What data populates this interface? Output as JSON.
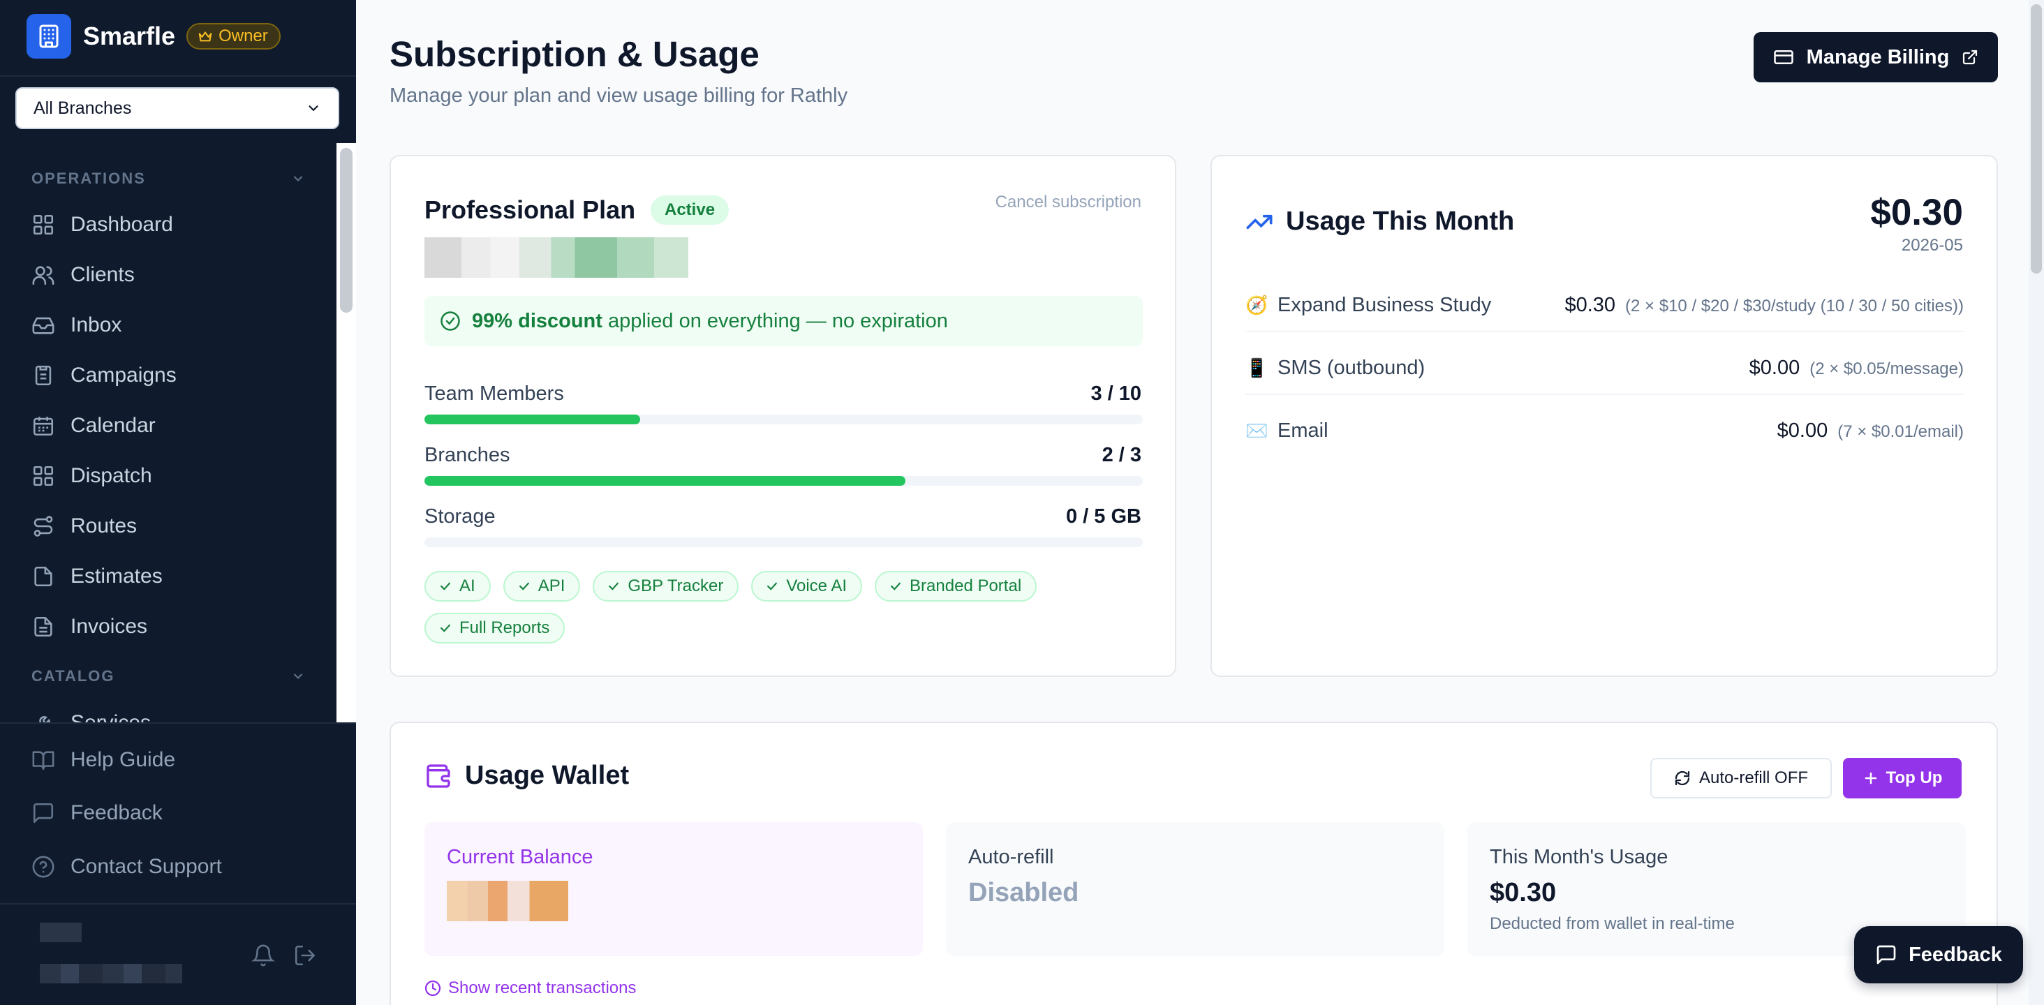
{
  "sidebar": {
    "brand": "Smarfle",
    "role_badge": "Owner",
    "branch_select": "All Branches",
    "sections": [
      {
        "label": "OPERATIONS",
        "items": [
          {
            "label": "Dashboard",
            "icon": "dashboard-icon"
          },
          {
            "label": "Clients",
            "icon": "clients-icon"
          },
          {
            "label": "Inbox",
            "icon": "inbox-icon"
          },
          {
            "label": "Campaigns",
            "icon": "campaigns-icon"
          },
          {
            "label": "Calendar",
            "icon": "calendar-icon"
          },
          {
            "label": "Dispatch",
            "icon": "dispatch-icon"
          },
          {
            "label": "Routes",
            "icon": "routes-icon"
          },
          {
            "label": "Estimates",
            "icon": "estimates-icon"
          },
          {
            "label": "Invoices",
            "icon": "invoices-icon"
          }
        ]
      },
      {
        "label": "CATALOG",
        "items": [
          {
            "label": "Services",
            "icon": "services-icon"
          }
        ]
      }
    ],
    "bottom": [
      {
        "label": "Help Guide",
        "icon": "book-icon"
      },
      {
        "label": "Feedback",
        "icon": "message-icon"
      },
      {
        "label": "Contact Support",
        "icon": "help-circle-icon"
      }
    ]
  },
  "header": {
    "title": "Subscription & Usage",
    "subtitle": "Manage your plan and view usage billing for Rathly",
    "manage_billing": "Manage Billing"
  },
  "plan": {
    "name": "Professional Plan",
    "status": "Active",
    "cancel": "Cancel subscription",
    "discount_bold": "99% discount",
    "discount_rest": "applied on everything — no expiration",
    "meters": [
      {
        "label": "Team Members",
        "value": "3 / 10",
        "fraction": 0.3
      },
      {
        "label": "Branches",
        "value": "2 / 3",
        "fraction": 0.67
      },
      {
        "label": "Storage",
        "value": "0 / 5 GB",
        "fraction": 0.0
      }
    ],
    "features": [
      "AI",
      "API",
      "GBP Tracker",
      "Voice AI",
      "Branded Portal",
      "Full Reports"
    ]
  },
  "usage": {
    "title": "Usage This Month",
    "total": "$0.30",
    "month": "2026-05",
    "rows": [
      {
        "icon": "compass-icon",
        "glyph": "🧭",
        "label": "Expand Business Study",
        "price": "$0.30",
        "detail": "(2 × $10 / $20 / $30/study (10 / 30 / 50 cities))"
      },
      {
        "icon": "phone-icon",
        "glyph": "📱",
        "label": "SMS (outbound)",
        "price": "$0.00",
        "detail": "(2 × $0.05/message)"
      },
      {
        "icon": "mail-icon",
        "glyph": "✉️",
        "label": "Email",
        "price": "$0.00",
        "detail": "(7 × $0.01/email)"
      }
    ]
  },
  "wallet": {
    "title": "Usage Wallet",
    "autorefill_button": "Auto-refill OFF",
    "topup_button": "Top Up",
    "tiles": [
      {
        "label": "Current Balance"
      },
      {
        "label": "Auto-refill",
        "value": "Disabled"
      },
      {
        "label": "This Month's Usage",
        "value": "$0.30",
        "note": "Deducted from wallet in real-time"
      }
    ],
    "show_transactions": "Show recent transactions"
  },
  "feedback_button": "Feedback",
  "colors": {
    "sidebar_bg": "#0f1b2d",
    "accent_blue": "#2563eb",
    "success_green": "#22c55e",
    "wallet_purple": "#9333ea",
    "owner_gold": "#fbbf24"
  }
}
